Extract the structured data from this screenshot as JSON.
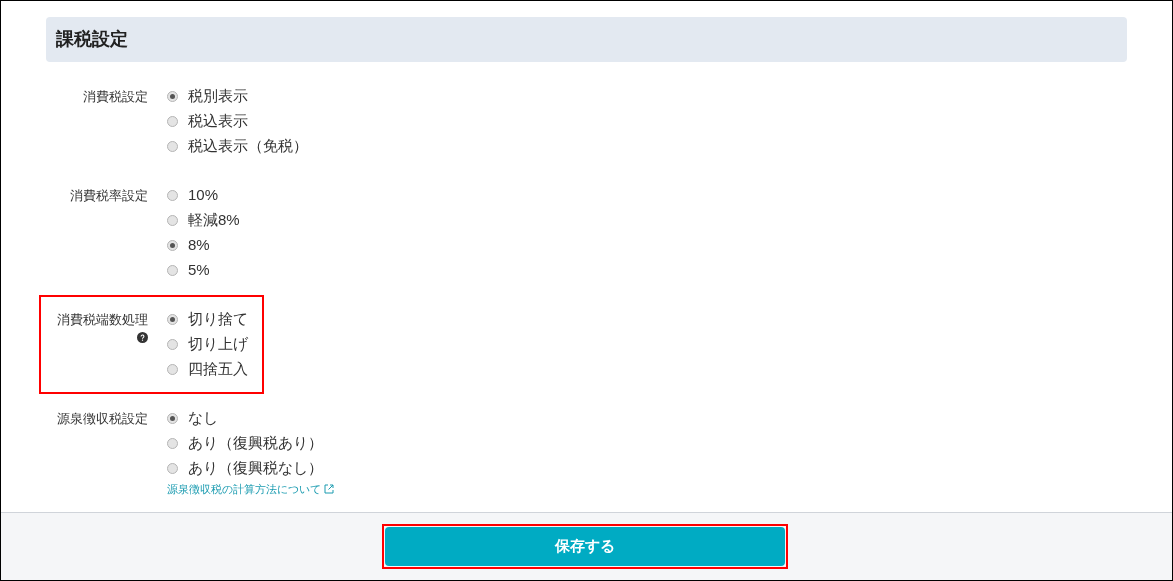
{
  "section": {
    "title": "課税設定"
  },
  "settings": [
    {
      "label": "消費税設定",
      "help": false,
      "highlighted": false,
      "options": [
        {
          "label": "税別表示",
          "selected": true
        },
        {
          "label": "税込表示",
          "selected": false
        },
        {
          "label": "税込表示（免税）",
          "selected": false
        }
      ]
    },
    {
      "label": "消費税率設定",
      "help": false,
      "highlighted": false,
      "options": [
        {
          "label": "10%",
          "selected": false
        },
        {
          "label": "軽減8%",
          "selected": false
        },
        {
          "label": "8%",
          "selected": true
        },
        {
          "label": "5%",
          "selected": false
        }
      ]
    },
    {
      "label": "消費税端数処理",
      "help": true,
      "highlighted": true,
      "options": [
        {
          "label": "切り捨て",
          "selected": true
        },
        {
          "label": "切り上げ",
          "selected": false
        },
        {
          "label": "四捨五入",
          "selected": false
        }
      ]
    },
    {
      "label": "源泉徴収税設定",
      "help": false,
      "highlighted": false,
      "options": [
        {
          "label": "なし",
          "selected": true
        },
        {
          "label": "あり（復興税あり）",
          "selected": false
        },
        {
          "label": "あり（復興税なし）",
          "selected": false
        }
      ],
      "link": "源泉徴収税の計算方法について"
    }
  ],
  "save_button": {
    "label": "保存する",
    "highlighted": true
  }
}
